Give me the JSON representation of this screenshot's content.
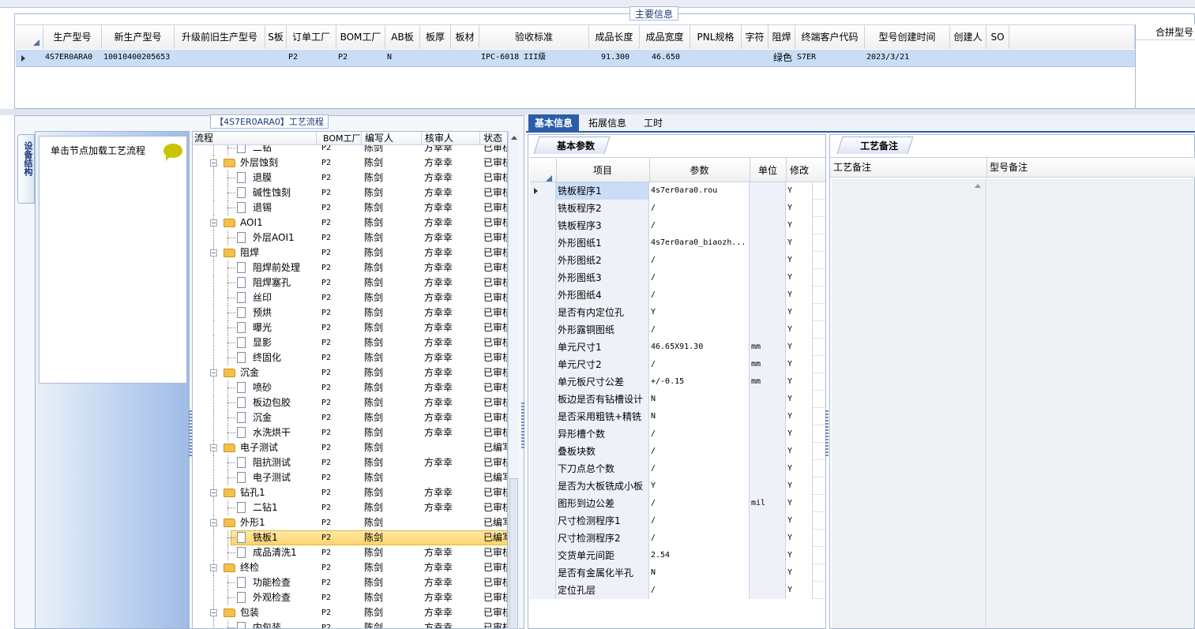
{
  "main_info": {
    "title": "主要信息",
    "columns": [
      "生产型号",
      "新生产型号",
      "升级前旧生产型号",
      "S板",
      "订单工厂",
      "BOM工厂",
      "AB板",
      "板厚",
      "板材",
      "验收标准",
      "成品长度",
      "成品宽度",
      "PNL规格",
      "字符",
      "阻焊",
      "终端客户代码",
      "型号创建时间",
      "创建人",
      "SO"
    ],
    "row": [
      "4S7ER0ARA0",
      "10010400205653",
      "",
      "",
      "P2",
      "P2",
      "N",
      "",
      "",
      "IPC-6018 III级",
      "91.300",
      "46.650",
      "",
      "",
      "绿色",
      "S7ER",
      "2023/3/21",
      "",
      ""
    ],
    "right_header": "合拼型号"
  },
  "process": {
    "title": "【4S7ER0ARA0】工艺流程",
    "side_tab": "设备结构",
    "hint": "单击节点加载工艺流程",
    "columns": [
      "流程",
      "BOM工厂",
      "编写人",
      "核审人",
      "状态"
    ],
    "rows": [
      {
        "level": 2,
        "name": "二钻",
        "bom": "P2",
        "writer": "陈剑",
        "reviewer": "方幸幸",
        "status": "已审核"
      },
      {
        "level": 1,
        "name": "外层蚀刻",
        "bom": "P2",
        "writer": "陈剑",
        "reviewer": "方幸幸",
        "status": "已审核"
      },
      {
        "level": 2,
        "name": "退膜",
        "bom": "P2",
        "writer": "陈剑",
        "reviewer": "方幸幸",
        "status": "已审核"
      },
      {
        "level": 2,
        "name": "碱性蚀刻",
        "bom": "P2",
        "writer": "陈剑",
        "reviewer": "方幸幸",
        "status": "已审核"
      },
      {
        "level": 2,
        "name": "退锡",
        "bom": "P2",
        "writer": "陈剑",
        "reviewer": "方幸幸",
        "status": "已审核"
      },
      {
        "level": 1,
        "name": "AOI1",
        "bom": "P2",
        "writer": "陈剑",
        "reviewer": "方幸幸",
        "status": "已审核"
      },
      {
        "level": 2,
        "name": "外层AOI1",
        "bom": "P2",
        "writer": "陈剑",
        "reviewer": "方幸幸",
        "status": "已审核"
      },
      {
        "level": 1,
        "name": "阻焊",
        "bom": "P2",
        "writer": "陈剑",
        "reviewer": "方幸幸",
        "status": "已审核"
      },
      {
        "level": 2,
        "name": "阻焊前处理",
        "bom": "P2",
        "writer": "陈剑",
        "reviewer": "方幸幸",
        "status": "已审核"
      },
      {
        "level": 2,
        "name": "阻焊塞孔",
        "bom": "P2",
        "writer": "陈剑",
        "reviewer": "方幸幸",
        "status": "已审核"
      },
      {
        "level": 2,
        "name": "丝印",
        "bom": "P2",
        "writer": "陈剑",
        "reviewer": "方幸幸",
        "status": "已审核"
      },
      {
        "level": 2,
        "name": "预烘",
        "bom": "P2",
        "writer": "陈剑",
        "reviewer": "方幸幸",
        "status": "已审核"
      },
      {
        "level": 2,
        "name": "曝光",
        "bom": "P2",
        "writer": "陈剑",
        "reviewer": "方幸幸",
        "status": "已审核"
      },
      {
        "level": 2,
        "name": "显影",
        "bom": "P2",
        "writer": "陈剑",
        "reviewer": "方幸幸",
        "status": "已审核"
      },
      {
        "level": 2,
        "name": "终固化",
        "bom": "P2",
        "writer": "陈剑",
        "reviewer": "方幸幸",
        "status": "已审核"
      },
      {
        "level": 1,
        "name": "沉金",
        "bom": "P2",
        "writer": "陈剑",
        "reviewer": "方幸幸",
        "status": "已审核"
      },
      {
        "level": 2,
        "name": "喷砂",
        "bom": "P2",
        "writer": "陈剑",
        "reviewer": "方幸幸",
        "status": "已审核"
      },
      {
        "level": 2,
        "name": "板边包胶",
        "bom": "P2",
        "writer": "陈剑",
        "reviewer": "方幸幸",
        "status": "已审核"
      },
      {
        "level": 2,
        "name": "沉金",
        "bom": "P2",
        "writer": "陈剑",
        "reviewer": "方幸幸",
        "status": "已审核"
      },
      {
        "level": 2,
        "name": "水洗烘干",
        "bom": "P2",
        "writer": "陈剑",
        "reviewer": "方幸幸",
        "status": "已审核"
      },
      {
        "level": 1,
        "name": "电子测试",
        "bom": "P2",
        "writer": "陈剑",
        "reviewer": "",
        "status": "已编写"
      },
      {
        "level": 2,
        "name": "阻抗测试",
        "bom": "P2",
        "writer": "陈剑",
        "reviewer": "方幸幸",
        "status": "已审核"
      },
      {
        "level": 2,
        "name": "电子测试",
        "bom": "P2",
        "writer": "陈剑",
        "reviewer": "",
        "status": "已编写"
      },
      {
        "level": 1,
        "name": "钻孔1",
        "bom": "P2",
        "writer": "陈剑",
        "reviewer": "方幸幸",
        "status": "已审核"
      },
      {
        "level": 2,
        "name": "二钻1",
        "bom": "P2",
        "writer": "陈剑",
        "reviewer": "方幸幸",
        "status": "已审核"
      },
      {
        "level": 1,
        "name": "外形1",
        "bom": "P2",
        "writer": "陈剑",
        "reviewer": "",
        "status": "已编写"
      },
      {
        "level": 2,
        "name": "铣板1",
        "bom": "P2",
        "writer": "陈剑",
        "reviewer": "",
        "status": "已编写",
        "selected": true
      },
      {
        "level": 2,
        "name": "成品清洗1",
        "bom": "P2",
        "writer": "陈剑",
        "reviewer": "方幸幸",
        "status": "已审核"
      },
      {
        "level": 1,
        "name": "终检",
        "bom": "P2",
        "writer": "陈剑",
        "reviewer": "方幸幸",
        "status": "已审核"
      },
      {
        "level": 2,
        "name": "功能检查",
        "bom": "P2",
        "writer": "陈剑",
        "reviewer": "方幸幸",
        "status": "已审核"
      },
      {
        "level": 2,
        "name": "外观检查",
        "bom": "P2",
        "writer": "陈剑",
        "reviewer": "方幸幸",
        "status": "已审核"
      },
      {
        "level": 1,
        "name": "包装",
        "bom": "P2",
        "writer": "陈剑",
        "reviewer": "方幸幸",
        "status": "已审核"
      },
      {
        "level": 2,
        "name": "内包装",
        "bom": "P2",
        "writer": "陈剑",
        "reviewer": "方幸幸",
        "status": "已审核"
      }
    ]
  },
  "tabs": [
    "基本信息",
    "拓展信息",
    "工时"
  ],
  "params": {
    "title": "基本参数",
    "columns": [
      "项目",
      "参数",
      "单位",
      "修改"
    ],
    "rows": [
      [
        "铣板程序1",
        "4s7er0ara0.rou",
        "",
        "Y"
      ],
      [
        "铣板程序2",
        "/",
        "",
        "Y"
      ],
      [
        "铣板程序3",
        "/",
        "",
        "Y"
      ],
      [
        "外形图纸1",
        "4s7er0ara0_biaozh...",
        "",
        "Y"
      ],
      [
        "外形图纸2",
        "/",
        "",
        "Y"
      ],
      [
        "外形图纸3",
        "/",
        "",
        "Y"
      ],
      [
        "外形图纸4",
        "/",
        "",
        "Y"
      ],
      [
        "是否有内定位孔",
        "Y",
        "",
        "Y"
      ],
      [
        "外形露铜图纸",
        "/",
        "",
        "Y"
      ],
      [
        "单元尺寸1",
        "46.65X91.30",
        "mm",
        "Y"
      ],
      [
        "单元尺寸2",
        "/",
        "mm",
        "Y"
      ],
      [
        "单元板尺寸公差",
        "+/-0.15",
        "mm",
        "Y"
      ],
      [
        "板边是否有钻槽设计",
        "N",
        "",
        "Y"
      ],
      [
        "是否采用粗铣+精铣",
        "N",
        "",
        "Y"
      ],
      [
        "异形槽个数",
        "/",
        "",
        "Y"
      ],
      [
        "叠板块数",
        "/",
        "",
        "Y"
      ],
      [
        "下刀点总个数",
        "/",
        "",
        "Y"
      ],
      [
        "是否为大板铣成小板",
        "Y",
        "",
        "Y"
      ],
      [
        "图形到边公差",
        "/",
        "mil",
        "Y"
      ],
      [
        "尺寸检测程序1",
        "/",
        "",
        "Y"
      ],
      [
        "尺寸检测程序2",
        "/",
        "",
        "Y"
      ],
      [
        "交货单元间距",
        "2.54",
        "",
        "Y"
      ],
      [
        "是否有金属化半孔",
        "N",
        "",
        "Y"
      ],
      [
        "定位孔层",
        "/",
        "",
        "Y"
      ]
    ]
  },
  "remarks": {
    "title": "工艺备注",
    "col1": "工艺备注",
    "col2": "型号备注"
  }
}
